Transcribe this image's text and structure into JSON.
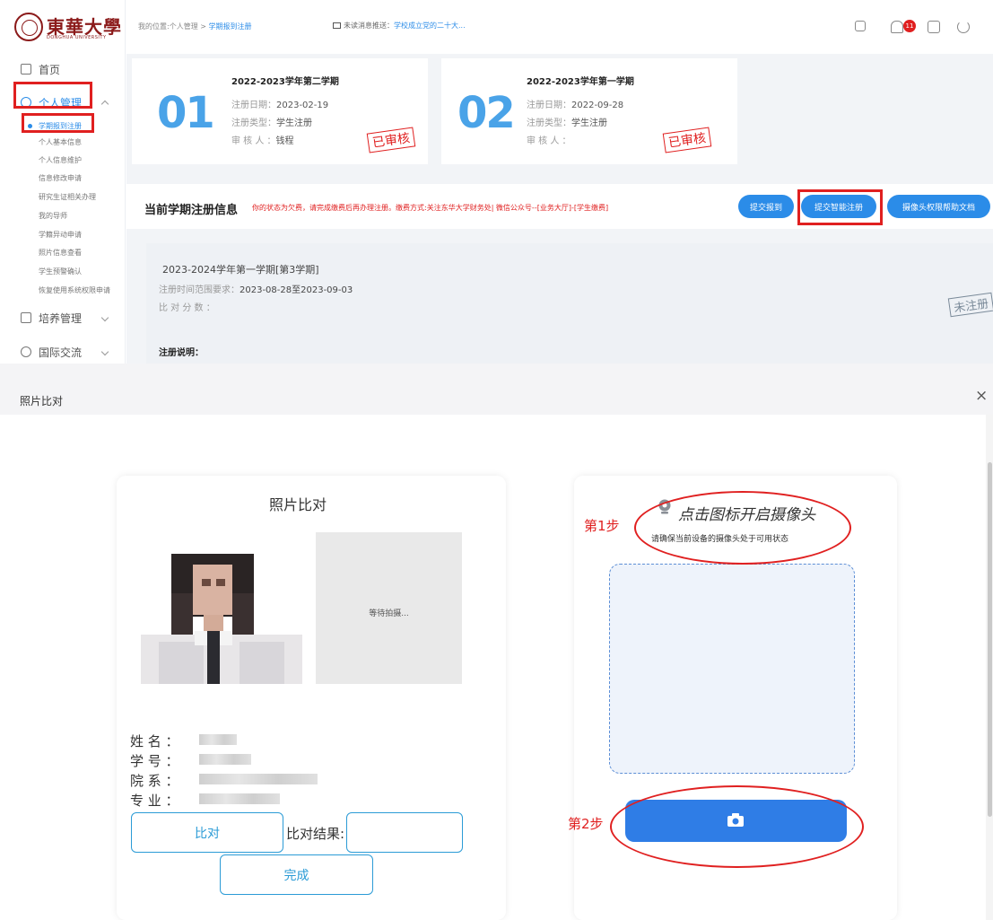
{
  "logo": {
    "name": "東華大學",
    "sub": "DONGHUA UNIVERSITY"
  },
  "sidebar": {
    "home": "首页",
    "personal": "个人管理",
    "sub_items": [
      "学期报到注册",
      "个人基本信息",
      "个人信息维护",
      "信息修改申请",
      "研究生证相关办理",
      "我的导师",
      "学籍异动申请",
      "照片信息查看",
      "学生预警确认",
      "恢复使用系统权限申请"
    ],
    "training": "培养管理",
    "international": "国际交流"
  },
  "topbar": {
    "crumb_prefix": "我的位置:个人管理 > ",
    "crumb_active": "学期报到注册",
    "msg_prefix": "未读消息推送：",
    "msg_link": "学校成立党的二十大...",
    "badge": "11"
  },
  "semesters": [
    {
      "num": "01",
      "title": "2022-2023学年第二学期",
      "date_label": "注册日期：",
      "date": "2023-02-19",
      "type_label": "注册类型：",
      "type": "学生注册",
      "reviewer_label": "审 核 人 ：",
      "reviewer": "钱程",
      "stamp": "已审核"
    },
    {
      "num": "02",
      "title": "2022-2023学年第一学期",
      "date_label": "注册日期：",
      "date": "2022-09-28",
      "type_label": "注册类型：",
      "type": "学生注册",
      "reviewer_label": "审 核 人 ：",
      "reviewer": "",
      "stamp": "已审核"
    }
  ],
  "current": {
    "title": "当前学期注册信息",
    "warning": "你的状态为欠费，请完成缴费后再办理注册。缴费方式:关注东华大学财务处| 微信公众号--[业务大厅]-[学生缴费]",
    "buttons": [
      "提交报到",
      "提交智能注册",
      "摄像头权限帮助文档"
    ],
    "semester": "2023-2024学年第一学期[第3学期]",
    "range_label": "注册时间范围要求：",
    "range": "2023-08-28至2023-09-03",
    "score_label": "比 对 分 数 ：",
    "stamp": "未注册",
    "note": "注册说明："
  },
  "modal": {
    "title": "照片比对",
    "close": "×",
    "left": {
      "title": "照片比对",
      "waiting": "等待拍摄...",
      "name_label": "姓 名 ：",
      "id_label": "学 号 ：",
      "dept_label": "院 系 ：",
      "major_label": "专 业 ：",
      "compare_btn": "比对",
      "result_label": "比对结果:",
      "result_value": "",
      "done_btn": "完成"
    },
    "right": {
      "tip": "点击图标开启摄像头",
      "sub": "请确保当前设备的摄像头处于可用状态"
    },
    "annotations": {
      "step1": "第1步",
      "step2": "第2步"
    }
  },
  "colors": {
    "brand": "#8b1a1a",
    "primary": "#2b8ce8",
    "annotation": "#e02020",
    "shoot": "#2f7de6"
  }
}
